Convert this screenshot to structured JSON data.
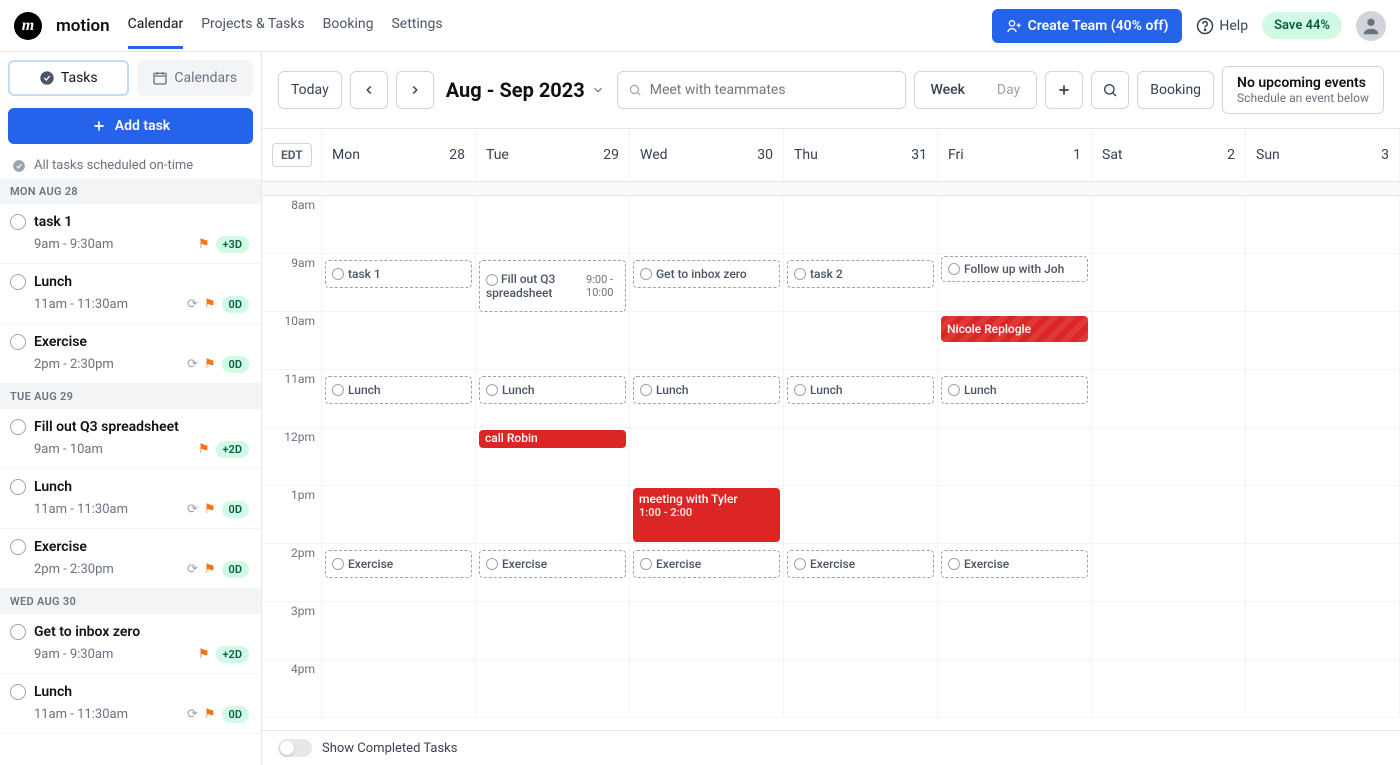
{
  "brand": "motion",
  "nav": {
    "calendar": "Calendar",
    "projects": "Projects & Tasks",
    "booking": "Booking",
    "settings": "Settings"
  },
  "header": {
    "createTeam": "Create Team (40% off)",
    "help": "Help",
    "savePill": "Save 44%"
  },
  "sidebar": {
    "tabs": {
      "tasks": "Tasks",
      "calendars": "Calendars"
    },
    "addTask": "Add task",
    "status": "All tasks scheduled on-time",
    "groups": [
      {
        "label": "MON AUG 28",
        "items": [
          {
            "title": "task 1",
            "time": "9am - 9:30am",
            "flag": true,
            "repeat": false,
            "badge": "+3D"
          },
          {
            "title": "Lunch",
            "time": "11am - 11:30am",
            "flag": true,
            "repeat": true,
            "badge": "0D"
          },
          {
            "title": "Exercise",
            "time": "2pm - 2:30pm",
            "flag": true,
            "repeat": true,
            "badge": "0D"
          }
        ]
      },
      {
        "label": "TUE AUG 29",
        "items": [
          {
            "title": "Fill out Q3 spreadsheet",
            "time": "9am - 10am",
            "flag": true,
            "repeat": false,
            "badge": "+2D"
          },
          {
            "title": "Lunch",
            "time": "11am - 11:30am",
            "flag": true,
            "repeat": true,
            "badge": "0D"
          },
          {
            "title": "Exercise",
            "time": "2pm - 2:30pm",
            "flag": true,
            "repeat": true,
            "badge": "0D"
          }
        ]
      },
      {
        "label": "WED AUG 30",
        "items": [
          {
            "title": "Get to inbox zero",
            "time": "9am - 9:30am",
            "flag": true,
            "repeat": false,
            "badge": "+2D"
          },
          {
            "title": "Lunch",
            "time": "11am - 11:30am",
            "flag": true,
            "repeat": true,
            "badge": "0D"
          }
        ]
      }
    ]
  },
  "toolbar": {
    "today": "Today",
    "range": "Aug - Sep 2023",
    "searchPlaceholder": "Meet with teammates",
    "week": "Week",
    "day": "Day",
    "booking": "Booking",
    "upcomingTitle": "No upcoming events",
    "upcomingSub": "Schedule an event below"
  },
  "calendar": {
    "tz": "EDT",
    "days": [
      {
        "name": "Mon",
        "num": "28"
      },
      {
        "name": "Tue",
        "num": "29"
      },
      {
        "name": "Wed",
        "num": "30"
      },
      {
        "name": "Thu",
        "num": "31"
      },
      {
        "name": "Fri",
        "num": "1"
      },
      {
        "name": "Sat",
        "num": "2"
      },
      {
        "name": "Sun",
        "num": "3"
      }
    ],
    "hours": [
      "8am",
      "9am",
      "10am",
      "11am",
      "12pm",
      "1pm",
      "2pm",
      "3pm",
      "4pm"
    ],
    "events": {
      "mon": {
        "task1": "task 1",
        "lunch": "Lunch",
        "exercise": "Exercise"
      },
      "tue": {
        "q3": "Fill out Q3 spreadsheet",
        "q3time": "9:00 - 10:00",
        "lunch": "Lunch",
        "callRobin": "call Robin",
        "exercise": "Exercise"
      },
      "wed": {
        "inbox": "Get to inbox zero",
        "lunch": "Lunch",
        "meeting": "meeting with Tyler",
        "meetingTime": "1:00 - 2:00",
        "exercise": "Exercise"
      },
      "thu": {
        "task2": "task 2",
        "lunch": "Lunch",
        "exercise": "Exercise"
      },
      "fri": {
        "follow": "Follow up with Joh",
        "nicole": "Nicole Replogle",
        "lunch": "Lunch",
        "exercise": "Exercise"
      }
    }
  },
  "footer": {
    "showCompleted": "Show Completed Tasks"
  }
}
